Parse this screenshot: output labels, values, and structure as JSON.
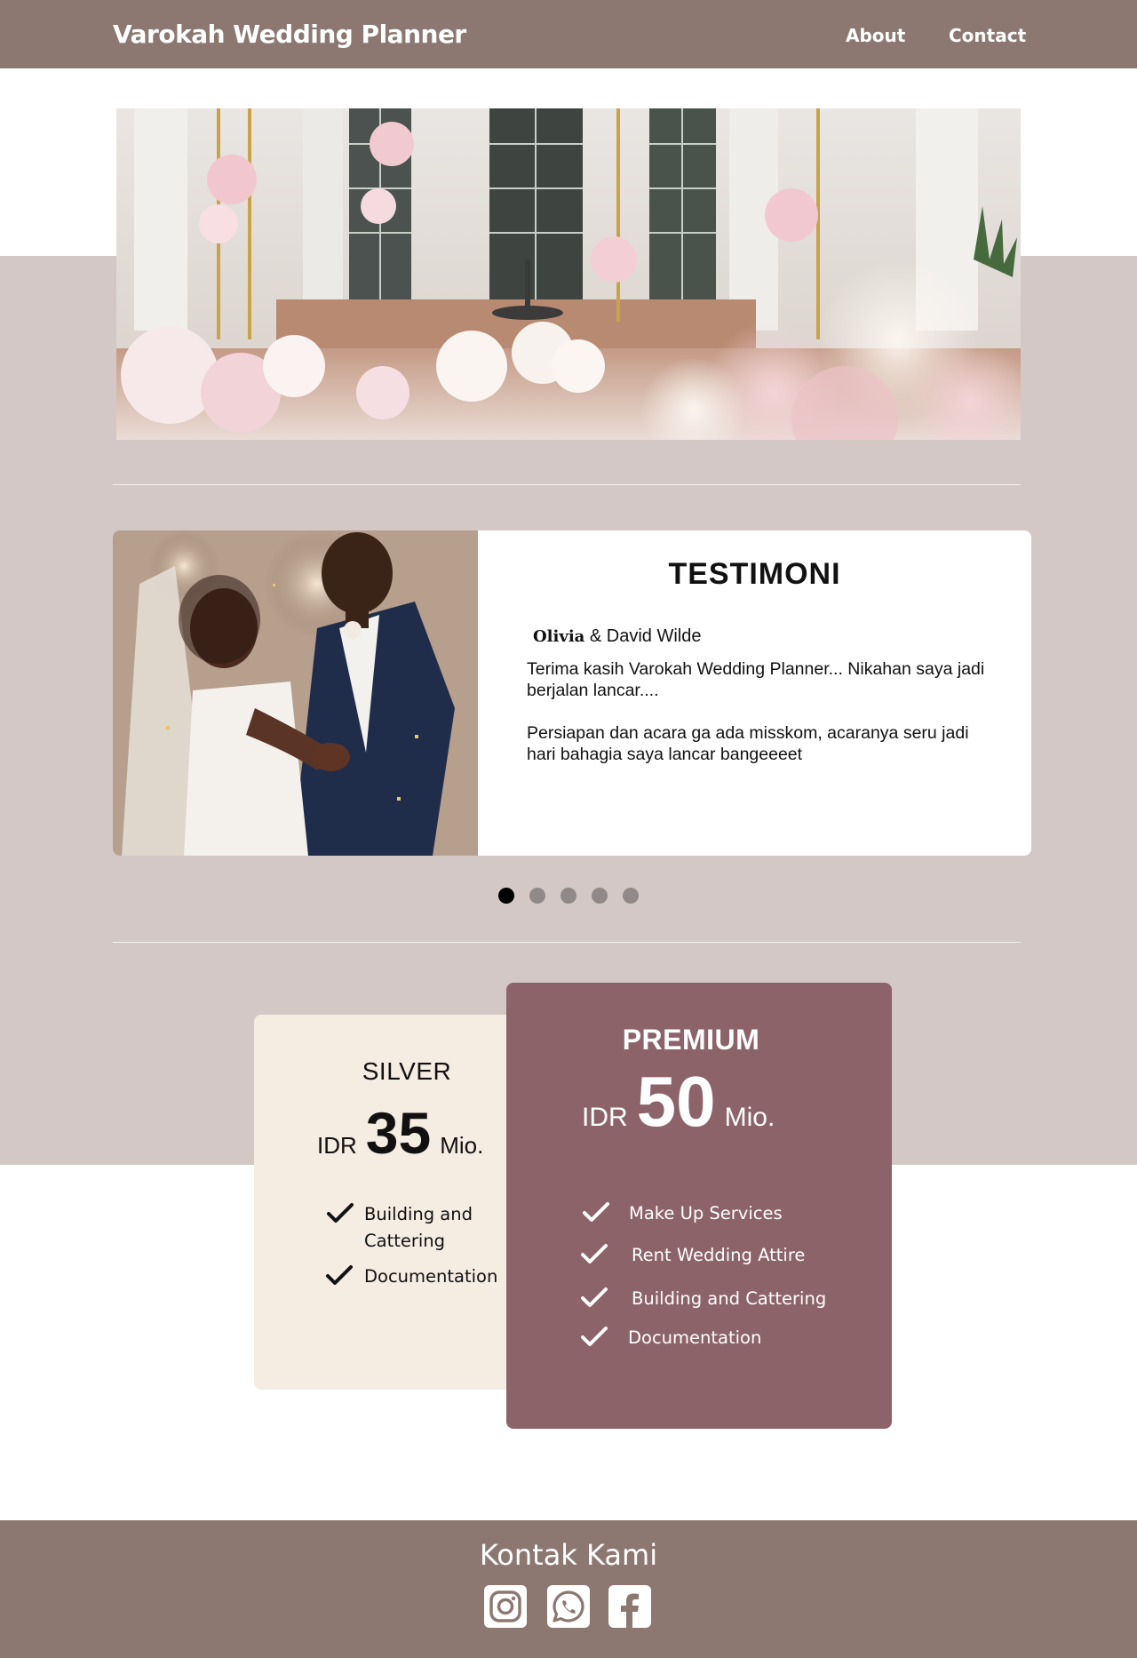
{
  "header": {
    "brand": "Varokah Wedding Planner",
    "nav": [
      {
        "label": "About"
      },
      {
        "label": "Contact"
      }
    ]
  },
  "testimonial": {
    "title": "TESTIMONI",
    "author_first": "Olivia",
    "author_rest": " & David Wilde",
    "paragraphs": [
      "Terima kasih Varokah Wedding Planner... Nikahan saya jadi berjalan lancar....",
      "Persiapan dan acara ga ada misskom, acaranya seru jadi hari bahagia saya lancar bangeeeet"
    ],
    "carousel": {
      "count": 5,
      "active_index": 0
    }
  },
  "pricing": {
    "silver": {
      "name": "SILVER",
      "currency": "IDR",
      "amount": "35",
      "unit": "Mio.",
      "features": [
        "Building and",
        "Cattering",
        "Documentation"
      ]
    },
    "premium": {
      "name": "PREMIUM",
      "currency": "IDR",
      "amount": "50",
      "unit": "Mio.",
      "features": [
        "Make Up Services",
        "Rent Wedding Attire",
        "Building and Cattering",
        "Documentation"
      ]
    }
  },
  "footer": {
    "title": "Kontak Kami",
    "social_icons": [
      "instagram-icon",
      "whatsapp-icon",
      "facebook-icon"
    ]
  },
  "colors": {
    "header_bg": "#8c7870",
    "band_bg": "#d3c8c6",
    "silver_bg": "#f5ece2",
    "premium_bg": "#8d636a"
  }
}
